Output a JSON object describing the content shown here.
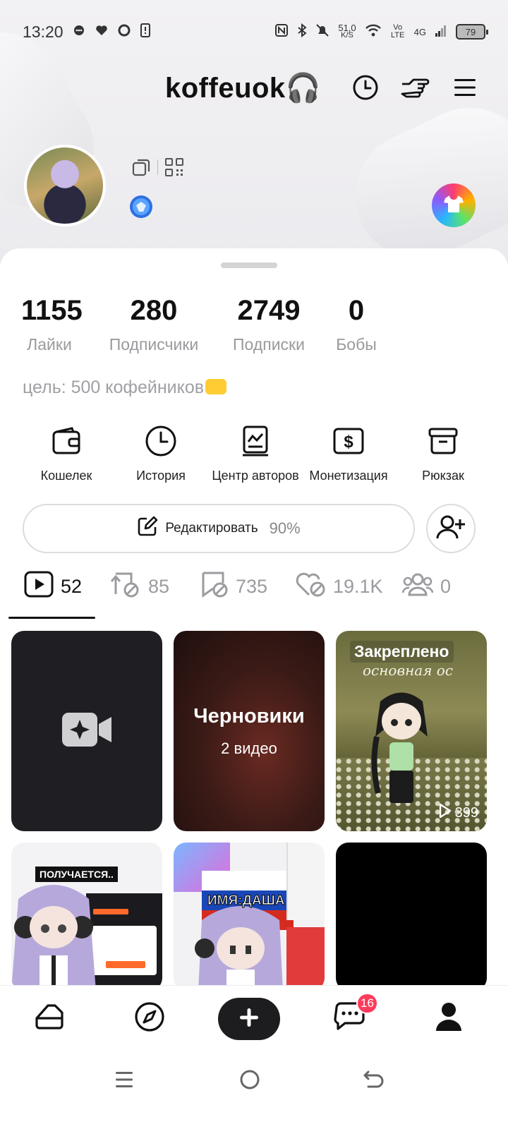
{
  "status_bar": {
    "time": "13:20",
    "net_speed_value": "51,0",
    "net_speed_unit": "K/S",
    "volte": "Vo LTE",
    "network": "4G",
    "battery": "79"
  },
  "header": {
    "username": "koffeuok🎧"
  },
  "stats": [
    {
      "value": "1155",
      "label": "Лайки"
    },
    {
      "value": "280",
      "label": "Подписчики"
    },
    {
      "value": "2749",
      "label": "Подписки"
    },
    {
      "value": "0",
      "label": "Бобы"
    }
  ],
  "bio": "цель: 500 кофейников",
  "tools": [
    {
      "label": "Кошелек",
      "icon": "wallet-icon"
    },
    {
      "label": "История",
      "icon": "clock-icon"
    },
    {
      "label": "Центр авторов",
      "icon": "creator-center-icon"
    },
    {
      "label": "Монетизация",
      "icon": "dollar-icon"
    },
    {
      "label": "Рюкзак",
      "icon": "backpack-icon"
    }
  ],
  "edit_profile": {
    "label": "Редактировать",
    "progress_text": "90%",
    "progress": 0.9
  },
  "content_tabs": [
    {
      "icon": "video-play-icon",
      "count": "52",
      "active": true
    },
    {
      "icon": "repost-icon",
      "count": "85",
      "active": false
    },
    {
      "icon": "bookmark-icon",
      "count": "735",
      "active": false
    },
    {
      "icon": "heart-icon",
      "count": "19.1K",
      "active": false
    },
    {
      "icon": "friends-icon",
      "count": "0",
      "active": false
    }
  ],
  "grid": {
    "drafts_title": "Черновики",
    "drafts_count": "2 видео",
    "pinned_label": "Закреплено",
    "pinned_views": "399",
    "pinned_caption": "основная ос",
    "tile4_caption": "ПОЛУЧАЕТСЯ..",
    "tile5_caption": "ИМЯ:ДАША"
  },
  "bottom_nav": {
    "items": [
      "home-icon",
      "compass-icon",
      "plus-icon",
      "messages-icon",
      "profile-icon"
    ],
    "messages_badge": "16"
  },
  "colors": {
    "badge": "#ff3b5c",
    "accent_dark": "#1d1d20"
  }
}
